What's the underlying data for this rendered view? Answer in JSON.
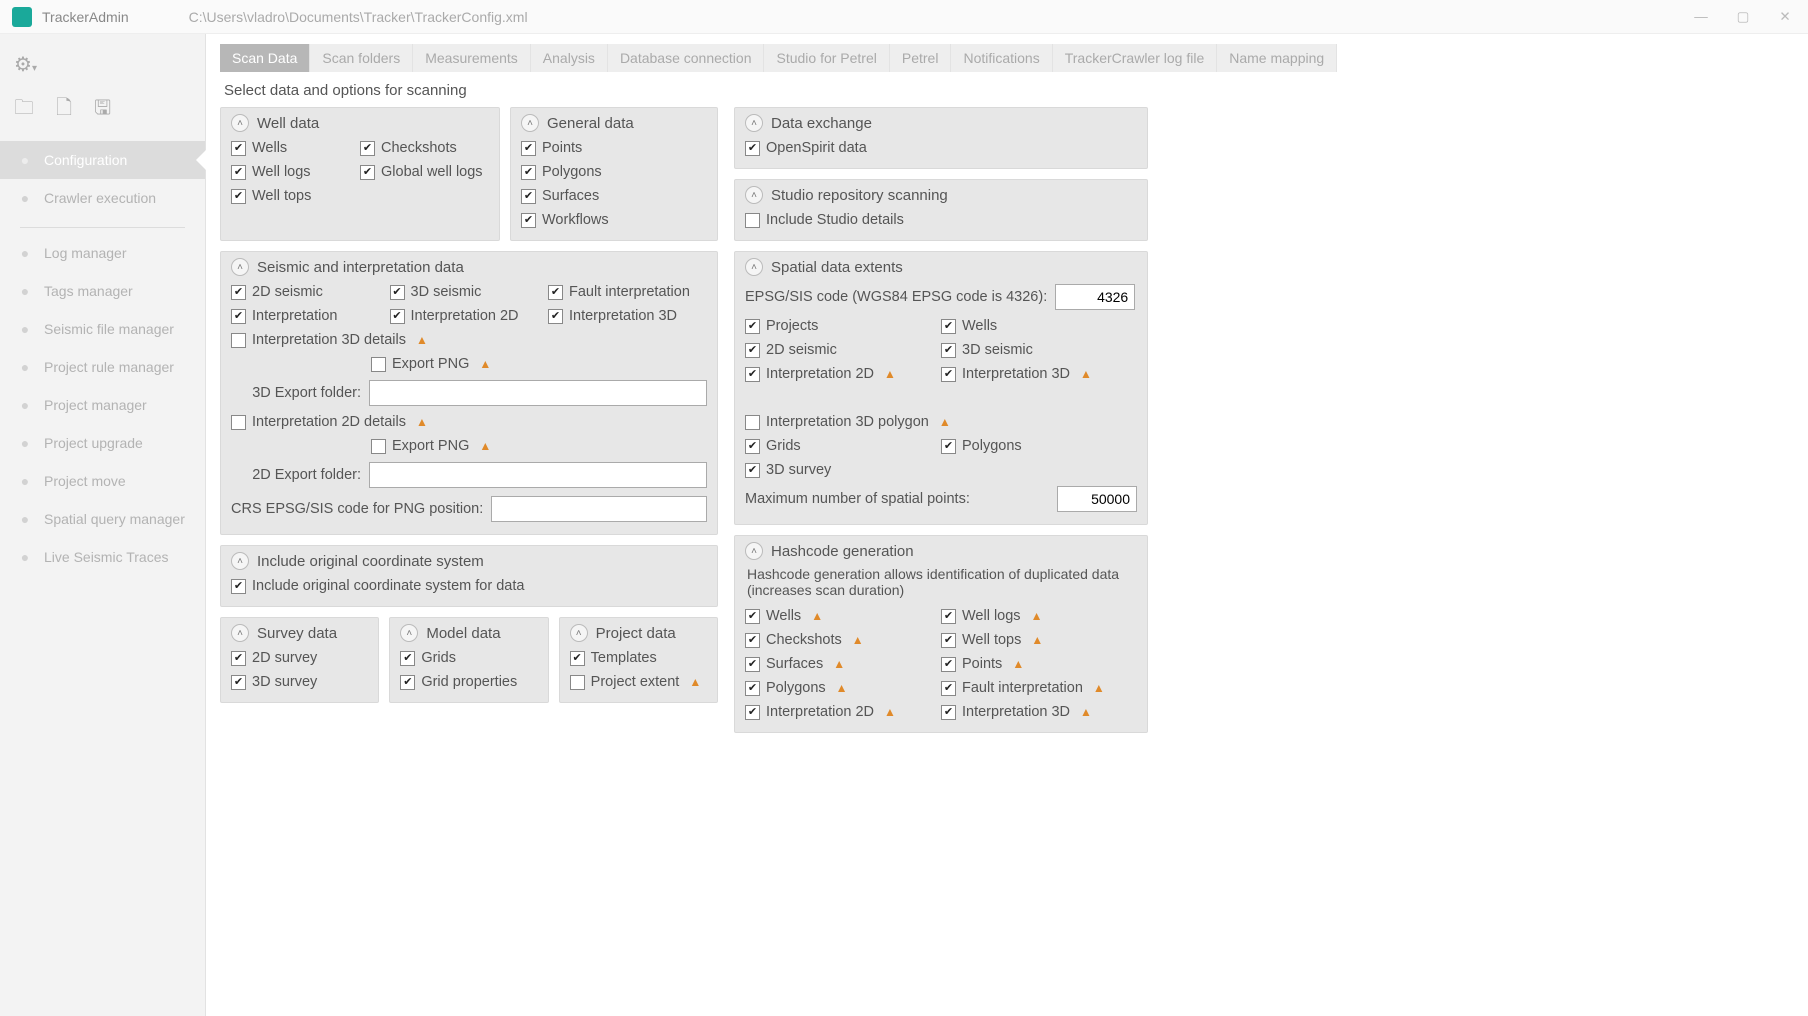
{
  "titlebar": {
    "app_name": "TrackerAdmin",
    "path": "C:\\Users\\vladro\\Documents\\Tracker\\TrackerConfig.xml"
  },
  "sidebar": {
    "items": [
      {
        "label": "Configuration",
        "icon": "wrench",
        "active": true
      },
      {
        "label": "Crawler execution",
        "icon": "starburst"
      },
      {
        "label": "Log manager",
        "icon": "doc"
      },
      {
        "label": "Tags manager",
        "icon": "tag"
      },
      {
        "label": "Seismic file manager",
        "icon": "tree"
      },
      {
        "label": "Project rule manager",
        "icon": "lines"
      },
      {
        "label": "Project manager",
        "icon": "check"
      },
      {
        "label": "Project upgrade",
        "icon": "refresh"
      },
      {
        "label": "Project move",
        "icon": "export"
      },
      {
        "label": "Spatial query manager",
        "icon": "layers"
      },
      {
        "label": "Live Seismic Traces",
        "icon": "globe"
      }
    ]
  },
  "tabs": [
    {
      "label": "Scan Data",
      "active": true
    },
    {
      "label": "Scan folders"
    },
    {
      "label": "Measurements"
    },
    {
      "label": "Analysis"
    },
    {
      "label": "Database connection"
    },
    {
      "label": "Studio for Petrel"
    },
    {
      "label": "Petrel"
    },
    {
      "label": "Notifications"
    },
    {
      "label": "TrackerCrawler log file"
    },
    {
      "label": "Name mapping"
    }
  ],
  "sectionTitle": "Select data and options for scanning",
  "panels": {
    "wellData": {
      "title": "Well data",
      "items": [
        {
          "label": "Wells",
          "checked": true
        },
        {
          "label": "Checkshots",
          "checked": true
        },
        {
          "label": "Well logs",
          "checked": true
        },
        {
          "label": "Global well logs",
          "checked": true
        },
        {
          "label": "Well tops",
          "checked": true
        }
      ]
    },
    "generalData": {
      "title": "General data",
      "items": [
        {
          "label": "Points",
          "checked": true
        },
        {
          "label": "Polygons",
          "checked": true
        },
        {
          "label": "Surfaces",
          "checked": true
        },
        {
          "label": "Workflows",
          "checked": true
        }
      ]
    },
    "seismic": {
      "title": "Seismic and interpretation data",
      "items": [
        {
          "label": "2D seismic",
          "checked": true
        },
        {
          "label": "3D seismic",
          "checked": true
        },
        {
          "label": "Fault interpretation",
          "checked": true
        },
        {
          "label": "Interpretation",
          "checked": true
        },
        {
          "label": "Interpretation 2D",
          "checked": true
        },
        {
          "label": "Interpretation 3D",
          "checked": true
        }
      ],
      "i3d_details": {
        "label": "Interpretation 3D details",
        "checked": false,
        "warn": true
      },
      "export_png_3d": {
        "label": "Export PNG",
        "checked": false,
        "warn": true
      },
      "folder3d_label": "3D Export folder:",
      "folder3d_value": "",
      "i2d_details": {
        "label": "Interpretation 2D details",
        "checked": false,
        "warn": true
      },
      "export_png_2d": {
        "label": "Export PNG",
        "checked": false,
        "warn": true
      },
      "folder2d_label": "2D Export folder:",
      "folder2d_value": "",
      "crs_label": "CRS EPSG/SIS code for PNG position:",
      "crs_value": ""
    },
    "coord": {
      "title": "Include original coordinate system",
      "item": {
        "label": "Include original coordinate system for data",
        "checked": true
      }
    },
    "survey": {
      "title": "Survey data",
      "items": [
        {
          "label": "2D survey",
          "checked": true
        },
        {
          "label": "3D survey",
          "checked": true
        }
      ]
    },
    "model": {
      "title": "Model data",
      "items": [
        {
          "label": "Grids",
          "checked": true
        },
        {
          "label": "Grid properties",
          "checked": true
        }
      ]
    },
    "project": {
      "title": "Project data",
      "items": [
        {
          "label": "Templates",
          "checked": true
        },
        {
          "label": "Project extent",
          "checked": false,
          "warn": true
        }
      ]
    },
    "dataExch": {
      "title": "Data exchange",
      "item": {
        "label": "OpenSpirit data",
        "checked": true
      }
    },
    "studio": {
      "title": "Studio repository scanning",
      "item": {
        "label": "Include Studio details",
        "checked": false
      }
    },
    "spatial": {
      "title": "Spatial data extents",
      "epsg_label": "EPSG/SIS code (WGS84 EPSG code is 4326):",
      "epsg_value": "4326",
      "items": [
        {
          "label": "Projects",
          "checked": true
        },
        {
          "label": "Wells",
          "checked": true
        },
        {
          "label": "2D seismic",
          "checked": true
        },
        {
          "label": "3D seismic",
          "checked": true
        },
        {
          "label": "Interpretation 2D",
          "checked": true,
          "warn": true
        },
        {
          "label": "Interpretation 3D",
          "checked": true,
          "warn": true
        },
        {
          "label": "",
          "empty": true
        },
        {
          "label": "Interpretation 3D polygon",
          "checked": false,
          "warn": true
        },
        {
          "label": "Grids",
          "checked": true
        },
        {
          "label": "Polygons",
          "checked": true
        },
        {
          "label": "3D survey",
          "checked": true
        }
      ],
      "max_label": "Maximum number of spatial points:",
      "max_value": "50000"
    },
    "hash": {
      "title": "Hashcode generation",
      "desc": "Hashcode generation allows identification of duplicated data (increases scan duration)",
      "items": [
        {
          "label": "Wells",
          "checked": true,
          "warn": true
        },
        {
          "label": "Well logs",
          "checked": true,
          "warn": true
        },
        {
          "label": "Checkshots",
          "checked": true,
          "warn": true
        },
        {
          "label": "Well tops",
          "checked": true,
          "warn": true
        },
        {
          "label": "Surfaces",
          "checked": true,
          "warn": true
        },
        {
          "label": "Points",
          "checked": true,
          "warn": true
        },
        {
          "label": "Polygons",
          "checked": true,
          "warn": true
        },
        {
          "label": "Fault interpretation",
          "checked": true,
          "warn": true
        },
        {
          "label": "Interpretation 2D",
          "checked": true,
          "warn": true
        },
        {
          "label": "Interpretation 3D",
          "checked": true,
          "warn": true
        }
      ]
    }
  }
}
